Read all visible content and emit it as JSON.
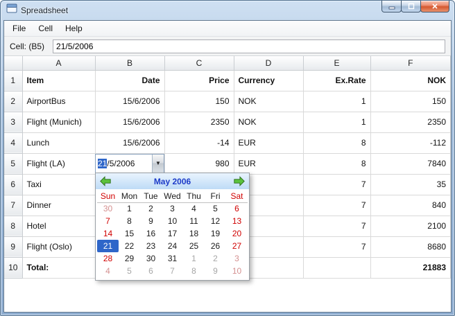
{
  "window": {
    "title": "Spreadsheet"
  },
  "menu": {
    "items": [
      "File",
      "Cell",
      "Help"
    ]
  },
  "formula_bar": {
    "cell_label": "Cell: (B5)",
    "value": "21/5/2006"
  },
  "spreadsheet": {
    "column_headers": [
      "A",
      "B",
      "C",
      "D",
      "E",
      "F"
    ],
    "rows": [
      {
        "num": "1",
        "header": true,
        "cells": [
          "Item",
          "Date",
          "Price",
          "Currency",
          "Ex.Rate",
          "NOK"
        ]
      },
      {
        "num": "2",
        "cells": [
          "AirportBus",
          "15/6/2006",
          "150",
          "NOK",
          "1",
          "150"
        ]
      },
      {
        "num": "3",
        "cells": [
          "Flight (Munich)",
          "15/6/2006",
          "2350",
          "NOK",
          "1",
          "2350"
        ]
      },
      {
        "num": "4",
        "cells": [
          "Lunch",
          "15/6/2006",
          "-14",
          "EUR",
          "8",
          "-112"
        ]
      },
      {
        "num": "5",
        "cells": [
          "Flight (LA)",
          "",
          "980",
          "EUR",
          "8",
          "7840"
        ]
      },
      {
        "num": "6",
        "cells": [
          "Taxi",
          "",
          "",
          "",
          "7",
          "35"
        ]
      },
      {
        "num": "7",
        "cells": [
          "Dinner",
          "",
          "",
          "",
          "7",
          "840"
        ]
      },
      {
        "num": "8",
        "cells": [
          "Hotel",
          "",
          "",
          "",
          "7",
          "2100"
        ]
      },
      {
        "num": "9",
        "cells": [
          "Flight (Oslo)",
          "",
          "",
          "",
          "7",
          "8680"
        ]
      },
      {
        "num": "10",
        "total": true,
        "cells": [
          "Total:",
          "",
          "",
          "",
          "",
          "21883"
        ]
      }
    ]
  },
  "date_editor": {
    "selected_part": "21",
    "rest": "/5/2006"
  },
  "calendar": {
    "month_label": "May 2006",
    "day_headers": [
      "Sun",
      "Mon",
      "Tue",
      "Wed",
      "Thu",
      "Fri",
      "Sat"
    ],
    "weeks": [
      [
        {
          "d": "30",
          "out": true
        },
        {
          "d": "1"
        },
        {
          "d": "2"
        },
        {
          "d": "3"
        },
        {
          "d": "4"
        },
        {
          "d": "5"
        },
        {
          "d": "6"
        }
      ],
      [
        {
          "d": "7"
        },
        {
          "d": "8"
        },
        {
          "d": "9"
        },
        {
          "d": "10"
        },
        {
          "d": "11"
        },
        {
          "d": "12"
        },
        {
          "d": "13"
        }
      ],
      [
        {
          "d": "14"
        },
        {
          "d": "15"
        },
        {
          "d": "16"
        },
        {
          "d": "17"
        },
        {
          "d": "18"
        },
        {
          "d": "19"
        },
        {
          "d": "20"
        }
      ],
      [
        {
          "d": "21",
          "sel": true
        },
        {
          "d": "22"
        },
        {
          "d": "23"
        },
        {
          "d": "24"
        },
        {
          "d": "25"
        },
        {
          "d": "26"
        },
        {
          "d": "27"
        }
      ],
      [
        {
          "d": "28"
        },
        {
          "d": "29"
        },
        {
          "d": "30"
        },
        {
          "d": "31"
        },
        {
          "d": "1",
          "out": true
        },
        {
          "d": "2",
          "out": true
        },
        {
          "d": "3",
          "out": true
        }
      ],
      [
        {
          "d": "4",
          "out": true
        },
        {
          "d": "5",
          "out": true
        },
        {
          "d": "6",
          "out": true
        },
        {
          "d": "7",
          "out": true
        },
        {
          "d": "8",
          "out": true
        },
        {
          "d": "9",
          "out": true
        },
        {
          "d": "10",
          "out": true
        }
      ]
    ]
  },
  "icons": {
    "dropdown_arrow": "▼"
  },
  "colors": {
    "num_blue": "#0000cc",
    "neg_red": "#cc0000",
    "weekend_red": "#d00000",
    "out_gray": "#a6a6a6",
    "out_weekend": "#d49090",
    "selection_blue": "#2e66c9",
    "month_label_blue": "#1c3bc8",
    "total_row_bg": "#d4d4d4"
  }
}
